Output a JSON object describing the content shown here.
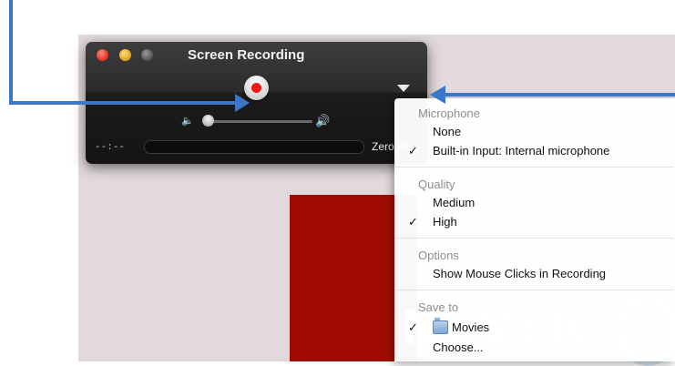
{
  "window": {
    "title": "Screen Recording"
  },
  "recorder": {
    "time": "--:--",
    "size": "Zero KB"
  },
  "menu": {
    "sections": [
      {
        "header": "Microphone",
        "items": [
          {
            "label": "None",
            "checked": false
          },
          {
            "label": "Built-in Input: Internal microphone",
            "checked": true
          }
        ]
      },
      {
        "header": "Quality",
        "items": [
          {
            "label": "Medium",
            "checked": false
          },
          {
            "label": "High",
            "checked": true
          }
        ]
      },
      {
        "header": "Options",
        "items": [
          {
            "label": "Show Mouse Clicks in Recording",
            "checked": false
          }
        ]
      },
      {
        "header": "Save to",
        "items": [
          {
            "label": "Movies",
            "checked": true,
            "icon": "folder-icon"
          },
          {
            "label": "Choose...",
            "checked": false
          }
        ]
      }
    ],
    "check_glyph": "✓"
  },
  "colors": {
    "record": "#f21818",
    "annotation_arrow": "#3b76c7",
    "backdrop_red": "#a10c02"
  }
}
